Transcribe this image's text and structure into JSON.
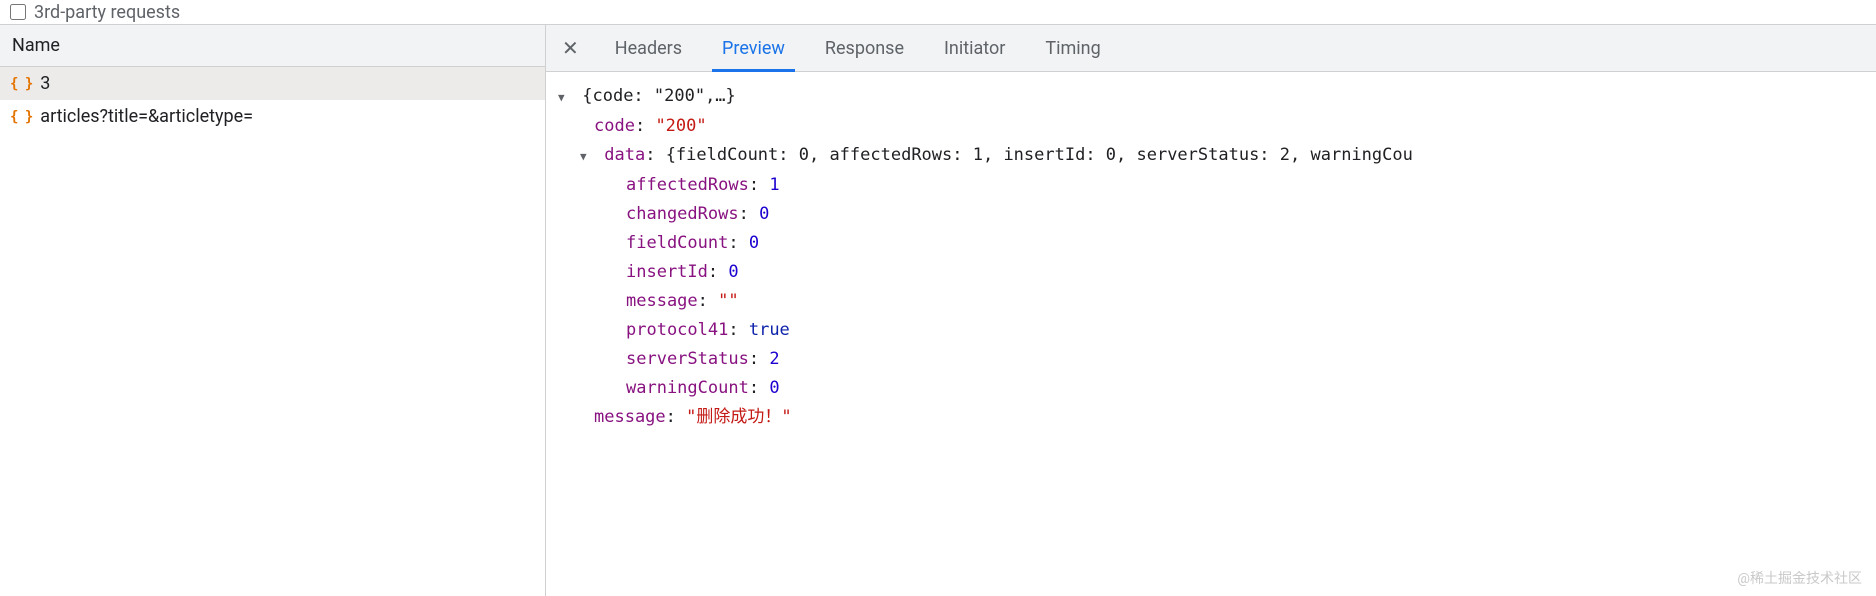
{
  "topFilter": {
    "label": "3rd-party requests"
  },
  "leftPanel": {
    "header": "Name",
    "requests": [
      {
        "name": "3",
        "selected": true
      },
      {
        "name": "articles?title=&articletype=",
        "selected": false
      }
    ]
  },
  "tabs": {
    "closeLabel": "✕",
    "items": [
      {
        "label": "Headers",
        "active": false
      },
      {
        "label": "Preview",
        "active": true
      },
      {
        "label": "Response",
        "active": false
      },
      {
        "label": "Initiator",
        "active": false
      },
      {
        "label": "Timing",
        "active": false
      }
    ]
  },
  "preview": {
    "rootSummary": "{code: \"200\",…}",
    "code": {
      "key": "code",
      "value": "\"200\""
    },
    "data": {
      "key": "data",
      "summary": "{fieldCount: 0, affectedRows: 1, insertId: 0, serverStatus: 2, warningCou",
      "fields": {
        "affectedRows": {
          "key": "affectedRows",
          "value": "1",
          "type": "num"
        },
        "changedRows": {
          "key": "changedRows",
          "value": "0",
          "type": "num"
        },
        "fieldCount": {
          "key": "fieldCount",
          "value": "0",
          "type": "num"
        },
        "insertId": {
          "key": "insertId",
          "value": "0",
          "type": "num"
        },
        "message": {
          "key": "message",
          "value": "\"\"",
          "type": "str"
        },
        "protocol41": {
          "key": "protocol41",
          "value": "true",
          "type": "bool"
        },
        "serverStatus": {
          "key": "serverStatus",
          "value": "2",
          "type": "num"
        },
        "warningCount": {
          "key": "warningCount",
          "value": "0",
          "type": "num"
        }
      }
    },
    "message": {
      "key": "message",
      "value": "\"删除成功！\""
    }
  },
  "watermark": "@稀土掘金技术社区"
}
